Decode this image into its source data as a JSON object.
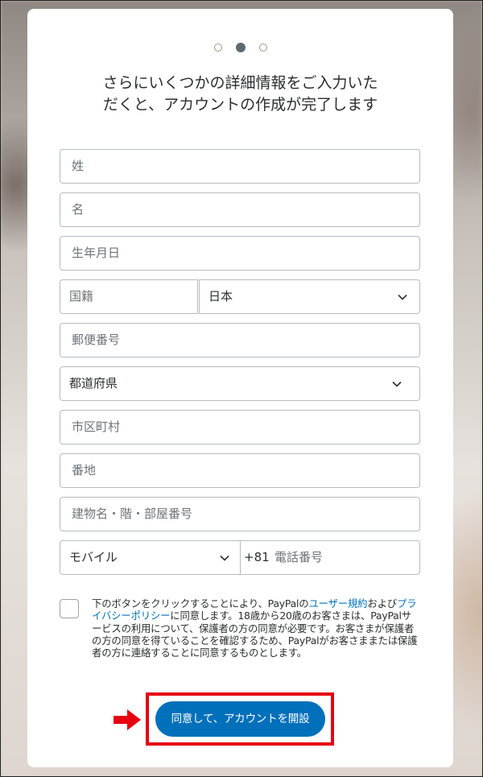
{
  "progress": {
    "total_steps": 3,
    "current_step": 2
  },
  "title_lines": [
    "さらにいくつかの詳細情報をご入力いた",
    "だくと、アカウントの作成が完了します"
  ],
  "form": {
    "last_name_placeholder": "姓",
    "first_name_placeholder": "名",
    "birthdate_placeholder": "生年月日",
    "nationality_label": "国籍",
    "nationality_value": "日本",
    "postal_code_placeholder": "郵便番号",
    "prefecture_value": "都道府県",
    "city_placeholder": "市区町村",
    "address_placeholder": "番地",
    "building_placeholder": "建物名・階・部屋番号",
    "phone_type_value": "モバイル",
    "phone_country_code": "+81",
    "phone_placeholder": "電話番号"
  },
  "terms": {
    "text_before_user_agreement": "下のボタンをクリックすることにより、PayPalの",
    "user_agreement_link": "ユーザー規約",
    "text_between": "および",
    "privacy_policy_link": "プライバシーポリシー",
    "text_after": "に同意します。18歳から20歳のお客さまは、PayPalサービスの利用について、保護者の方の同意が必要です。お客さまが保護者の方の同意を得ていることを確認するため、PayPalがお客さままたは保護者の方に連絡することに同意するものとします。"
  },
  "submit_button_label": "同意して、アカウントを開設",
  "colors": {
    "primary": "#0070ba",
    "annotation": "#e60012",
    "text": "#2c2e2f",
    "placeholder": "#6c7378"
  }
}
